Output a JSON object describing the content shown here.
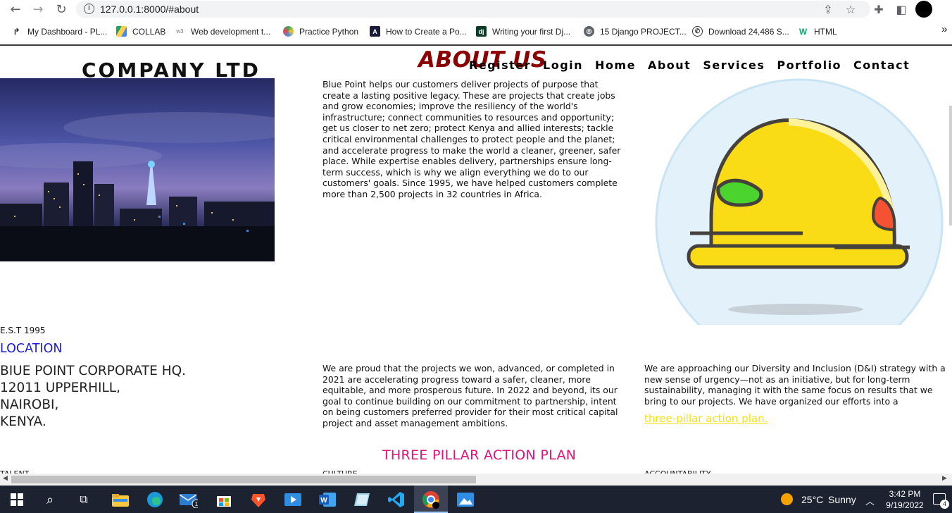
{
  "browser": {
    "url": "127.0.0.1:8000/#about",
    "bookmarks": [
      {
        "label": "My Dashboard - PL...",
        "icon": "page-icon"
      },
      {
        "label": "COLLAB",
        "icon": "google-drive-icon"
      },
      {
        "label": "Web development t...",
        "icon": "w3schools-icon"
      },
      {
        "label": "Practice Python",
        "icon": "python-icon"
      },
      {
        "label": "How to Create a Po...",
        "icon": "blog-icon"
      },
      {
        "label": "Writing your first Dj...",
        "icon": "django-icon"
      },
      {
        "label": "15 Django PROJECT...",
        "icon": "globe-icon"
      },
      {
        "label": "Download 24,486 S...",
        "icon": "whatsapp-icon"
      },
      {
        "label": "HTML",
        "icon": "w3-icon"
      }
    ],
    "more_label": "»"
  },
  "site": {
    "company": "COMPANY LTD",
    "about_title": "ABOUT US",
    "menu": [
      "Register",
      "Login",
      "Home",
      "About",
      "Services",
      "Portfolio",
      "Contact"
    ],
    "intro": "Blue Point helps our customers deliver projects of purpose that create a lasting positive legacy. These are projects that create jobs and grow economies; improve the resiliency of the world's infrastructure; connect communities to resources and opportunity; get us closer to net zero; protect Kenya and allied interests; tackle critical environmental challenges to protect people and the planet; and accelerate progress to make the world a cleaner, greener, safer place. While expertise enables delivery, partnerships ensure long-term success, which is why we align everything we do to our customers' goals. Since 1995, we have helped customers complete more than 2,500 projects in 32 countries in Africa.",
    "est": "E.S.T 1995",
    "location_title": "LOCATION",
    "address_lines": [
      "BIUE POINT CORPORATE HQ.",
      "12011 UPPERHILL,",
      "NAIROBI,",
      "KENYA."
    ],
    "proud": "We are proud that the projects we won, advanced, or completed in 2021 are accelerating progress toward a safer, cleaner, more equitable, and more prosperous future. In 2022 and beyond, its our goal to continue building on our commitment to partnership, intent on being customers preferred provider for their most critical capital project and asset management ambitions.",
    "diversity": "We are approaching our Diversity and Inclusion (D&I) strategy with a new sense of urgency—not as an initiative, but for long-term sustainability, managing it with the same focus on results that we bring to our projects. We have organized our efforts into a",
    "pillar_link": "three-pillar action plan.",
    "pillar_title": "THREE PILLAR ACTION PLAN",
    "columns_cut": [
      "TALENT",
      "CULTURE",
      "ACCOUNTABILITY"
    ]
  },
  "taskbar": {
    "weather_temp": "25°C",
    "weather_text": "Sunny",
    "time": "3:42 PM",
    "date": "9/19/2022",
    "mail_badge": "1",
    "notif_badge": "4"
  },
  "colors": {
    "about_title": "#8b0000",
    "location": "#1a1adc",
    "pillar_title": "#e0127a",
    "pillar_link": "#f6e20a"
  }
}
